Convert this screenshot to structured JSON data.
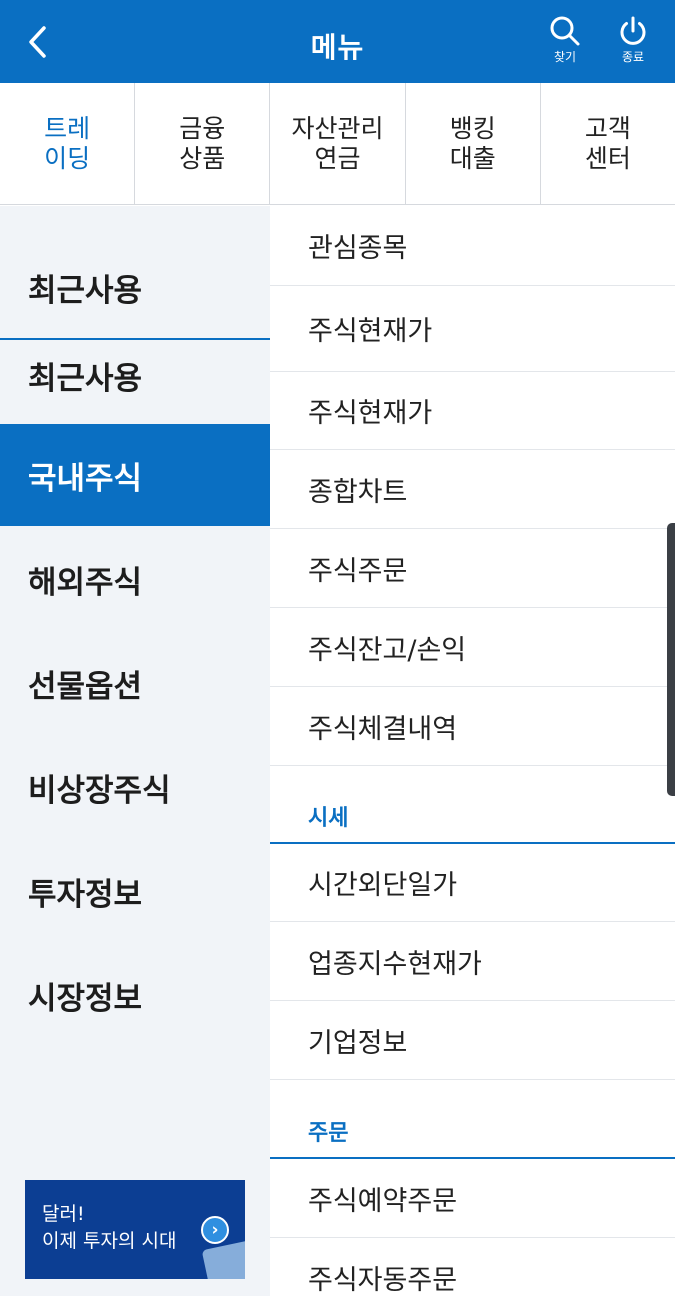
{
  "header": {
    "title": "메뉴",
    "search_label": "찾기",
    "exit_label": "종료"
  },
  "categories": [
    {
      "line1": "트레",
      "line2": "이딩"
    },
    {
      "line1": "금융",
      "line2": "상품"
    },
    {
      "line1": "자산관리",
      "line2": "연금"
    },
    {
      "line1": "뱅킹",
      "line2": "대출"
    },
    {
      "line1": "고객",
      "line2": "센터"
    }
  ],
  "left_tabs": [
    "최근사용",
    "최근사용",
    "국내주식",
    "해외주식",
    "선물옵션",
    "비상장주식",
    "투자정보",
    "시장정보"
  ],
  "right_items": {
    "i0": "관심종목",
    "i1": "주식현재가",
    "i2": "주식현재가",
    "i3": "종합차트",
    "i4": "주식주문",
    "i5": "주식잔고/손익",
    "i6": "주식체결내역",
    "sec_quote": "시세",
    "i7": "시간외단일가",
    "i8": "업종지수현재가",
    "i9": "기업정보",
    "sec_order": "주문",
    "i10": "주식예약주문",
    "i11": "주식자동주문"
  },
  "banner": {
    "line1": "달러!",
    "line2": "이제 투자의 시대"
  },
  "colors": {
    "brand": "#0a6fc2",
    "banner_bg": "#0c3e93"
  }
}
